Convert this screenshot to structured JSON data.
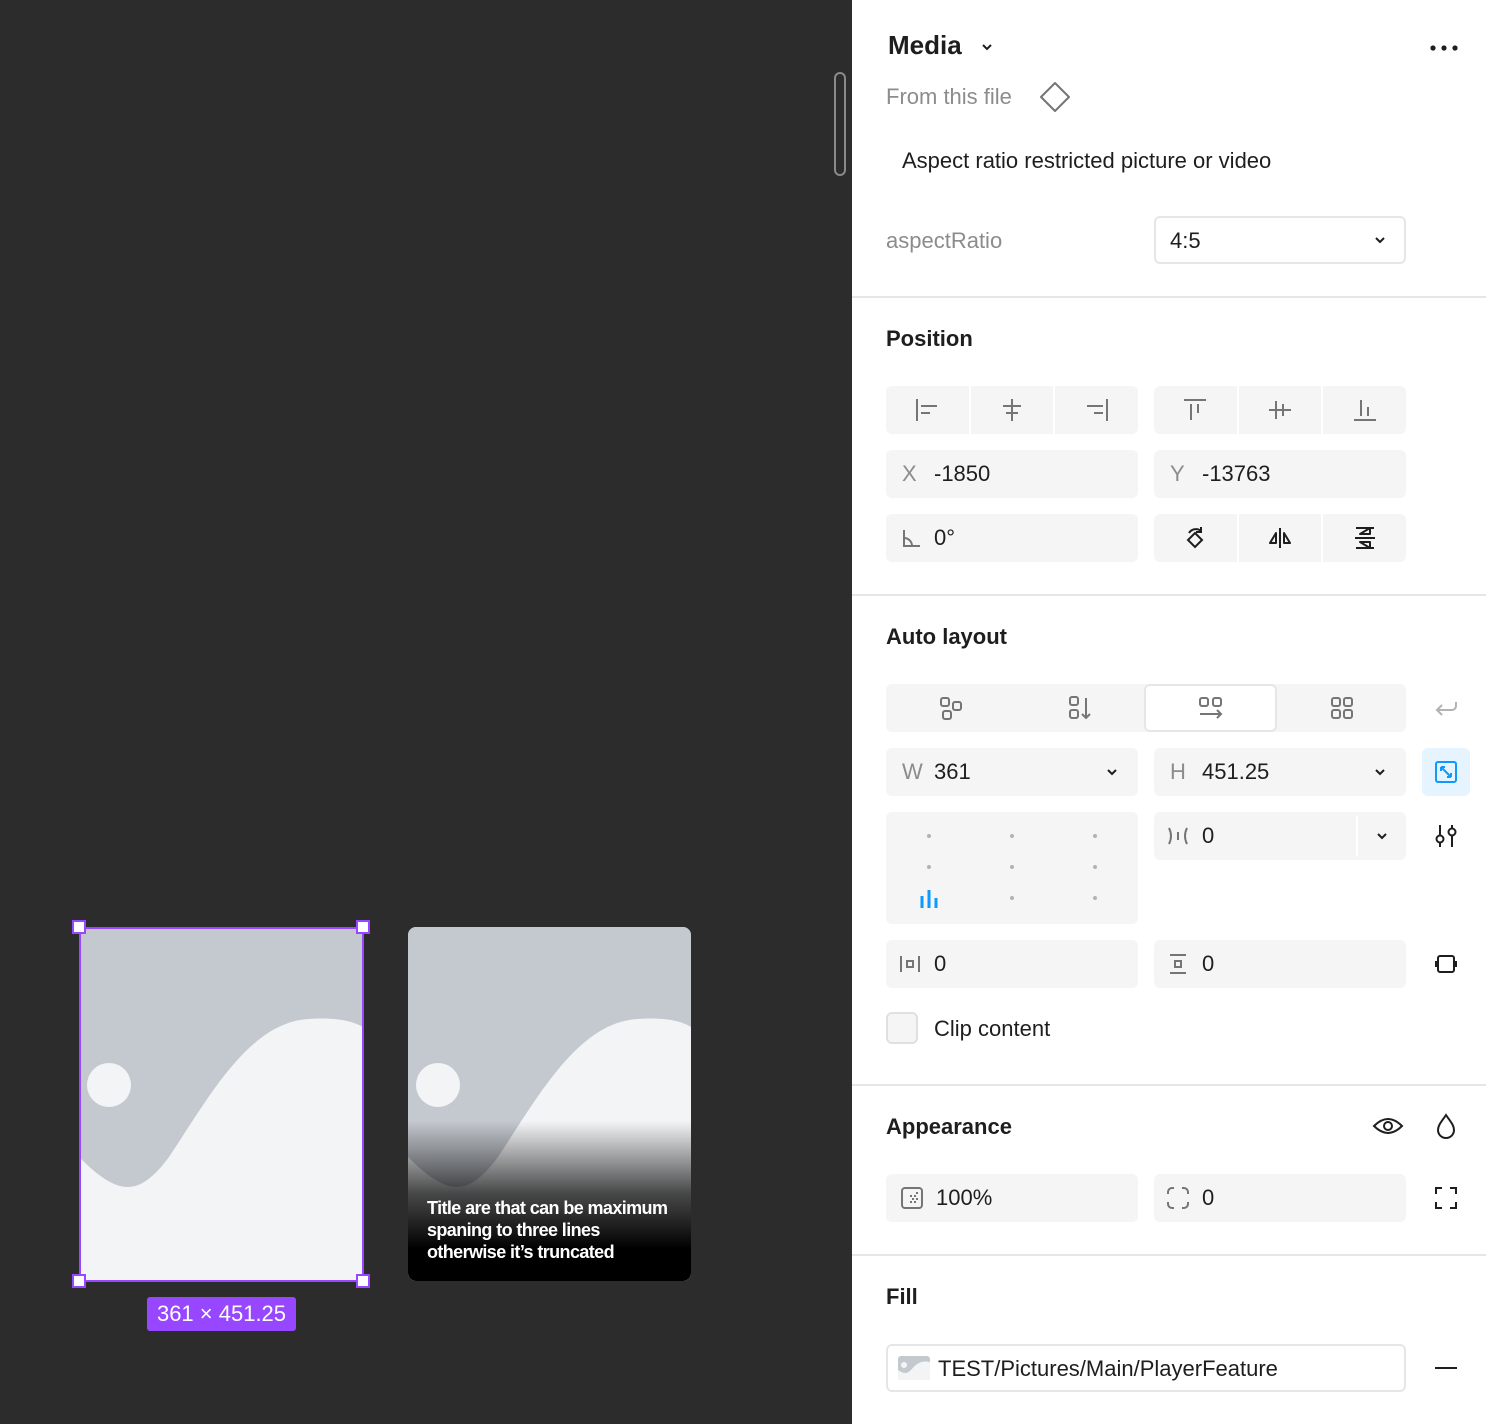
{
  "canvas": {
    "selected_size_label": "361 × 451.25",
    "card2_title": "Title are that can be maximum spaning to three lines otherwise it’s truncated"
  },
  "panel": {
    "component_name": "Media",
    "source_label": "From this file",
    "description": "Aspect ratio restricted picture or video",
    "aspect_ratio": {
      "label": "aspectRatio",
      "value": "4:5"
    },
    "position": {
      "title": "Position",
      "x_label": "X",
      "x_value": "-1850",
      "y_label": "Y",
      "y_value": "-13763",
      "rotation_value": "0°"
    },
    "auto_layout": {
      "title": "Auto layout",
      "w_label": "W",
      "w_value": "361",
      "h_label": "H",
      "h_value": "451.25",
      "gap_value": "0",
      "padding_h_value": "0",
      "padding_v_value": "0",
      "clip_label": "Clip content",
      "clip_checked": false
    },
    "appearance": {
      "title": "Appearance",
      "opacity_value": "100%",
      "radius_value": "0"
    },
    "fill": {
      "title": "Fill",
      "image_name": "TEST/Pictures/Main/PlayerFeature"
    },
    "colors": {
      "accent": "#9747ff",
      "blue": "#0d99ff"
    }
  }
}
